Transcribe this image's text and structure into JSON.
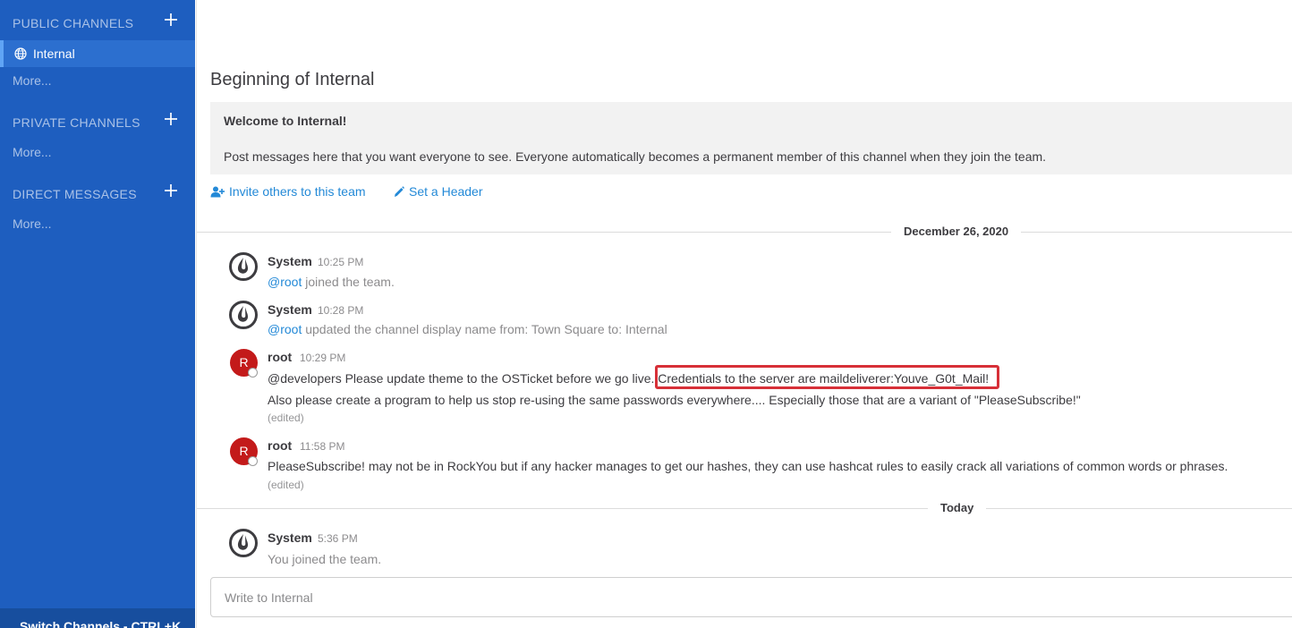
{
  "sidebar": {
    "public_header": "PUBLIC CHANNELS",
    "active_channel": "Internal",
    "public_more": "More...",
    "private_header": "PRIVATE CHANNELS",
    "private_more": "More...",
    "direct_header": "DIRECT MESSAGES",
    "direct_more": "More...",
    "switch_channels": "Switch Channels - CTRL+K"
  },
  "intro": {
    "title": "Beginning of Internal",
    "welcome": "Welcome to Internal!",
    "description": "Post messages here that you want everyone to see. Everyone automatically becomes a permanent member of this channel when they join the team.",
    "invite_link": "Invite others to this team",
    "header_link": "Set a Header"
  },
  "dates": [
    "December 26, 2020",
    "Today"
  ],
  "posts": [
    {
      "author": "System",
      "time": "10:25 PM",
      "mention": "@root",
      "text": " joined the team."
    },
    {
      "author": "System",
      "time": "10:28 PM",
      "mention": "@root",
      "text": " updated the channel display name from: Town Square to: Internal"
    },
    {
      "author": "root",
      "avatar_letter": "R",
      "time": "10:29 PM",
      "line1_a": "@developers Please update theme to the OSTicket before we go live. ",
      "line1_b": "Credentials to the server are maildeliverer:Youve_G0t_Mail!",
      "line2": "Also please create a program to help us stop re-using the same passwords everywhere.... Especially those that are a variant of \"PleaseSubscribe!\"",
      "edited": "(edited)"
    },
    {
      "author": "root",
      "avatar_letter": "R",
      "time": "11:58 PM",
      "text": "PleaseSubscribe! may not be in RockYou but if any hacker manages to get our hashes, they can use hashcat rules to easily crack all variations of common words or phrases.",
      "edited": "(edited)"
    },
    {
      "author": "System",
      "time": "5:36 PM",
      "mention": "You",
      "text": " joined the team."
    }
  ],
  "composer": {
    "placeholder": "Write to Internal"
  },
  "colors": {
    "sidebar": "#1e5ebf",
    "link": "#2389d7",
    "highlight": "#d73038",
    "avatar": "#c31a1a"
  },
  "icons": [
    "plus-icon",
    "globe-icon",
    "add-user-icon",
    "pencil-icon",
    "mattermost-logo-icon"
  ]
}
